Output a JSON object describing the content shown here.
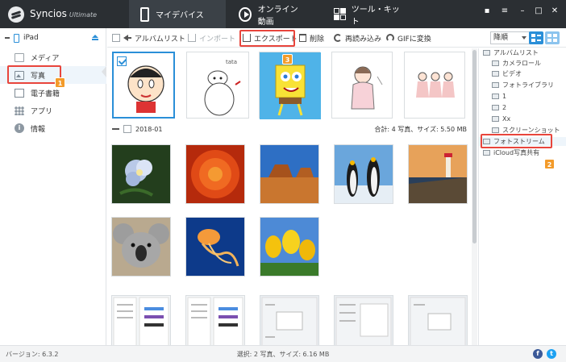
{
  "app": {
    "brand": "Syncios",
    "edition": "Ultimate",
    "tabs": [
      {
        "label": "マイデバイス",
        "icon": "phone-icon"
      },
      {
        "label": "オンライン動画",
        "icon": "play-icon"
      },
      {
        "label": "ツール・キット",
        "icon": "tools-icon"
      }
    ],
    "window_buttons": [
      "chat-icon",
      "menu-icon",
      "minimize-icon",
      "maximize-icon",
      "close-icon"
    ]
  },
  "sidebar": {
    "device": "iPad",
    "items": [
      {
        "label": "メディア",
        "icon": "folder-icon"
      },
      {
        "label": "写真",
        "icon": "photo-icon"
      },
      {
        "label": "電子書籍",
        "icon": "book-icon"
      },
      {
        "label": "アプリ",
        "icon": "apps-icon"
      },
      {
        "label": "情報",
        "icon": "info-icon"
      }
    ]
  },
  "toolbar": {
    "album_list": "アルバムリスト",
    "import": "インポート",
    "export": "エクスポート",
    "delete": "削除",
    "reload": "再読み込み",
    "gif": "GIFに変換",
    "sort": "降順"
  },
  "main": {
    "date_group": "2018-01",
    "summary": "合計: 4 写真、サイズ: 5.50 MB"
  },
  "right_panel": {
    "items": [
      {
        "label": "アルバムリスト",
        "indent": 0
      },
      {
        "label": "カメラロール",
        "indent": 1
      },
      {
        "label": "ビデオ",
        "indent": 1
      },
      {
        "label": "フォトライブラリ",
        "indent": 1
      },
      {
        "label": "1",
        "indent": 1
      },
      {
        "label": "2",
        "indent": 1
      },
      {
        "label": "Xx",
        "indent": 1
      },
      {
        "label": "スクリーンショット",
        "indent": 1
      },
      {
        "label": "フォトストリーム",
        "indent": 0
      },
      {
        "label": "iCloud写真共有",
        "indent": 0
      }
    ]
  },
  "annotations": {
    "badge_1": "1",
    "badge_2": "2",
    "badge_3": "3"
  },
  "status": {
    "version": "バージョン: 6.3.2",
    "selection": "選択: 2 写真、サイズ: 6.16 MB",
    "facebook": "f",
    "twitter": "t"
  },
  "colors": {
    "titlebar": "#2b2f33",
    "accent": "#2a8fd8",
    "highlight": "#e8453c",
    "badge": "#f39b2a"
  }
}
